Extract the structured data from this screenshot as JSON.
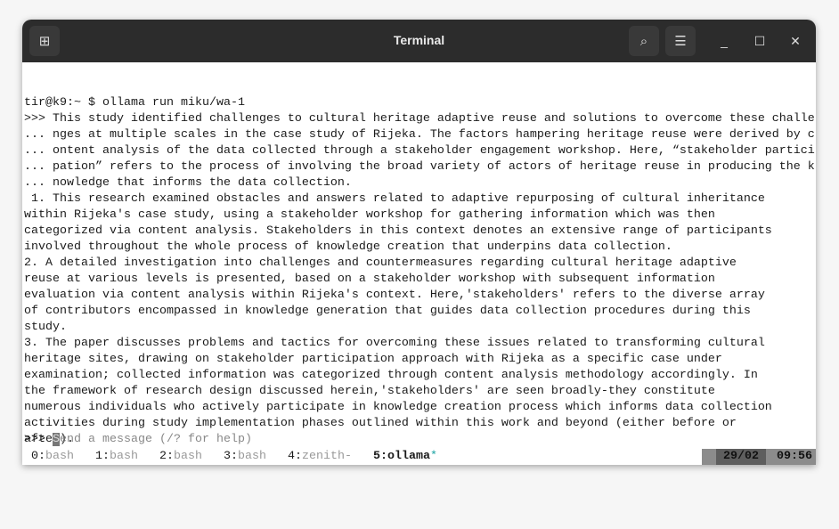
{
  "window": {
    "title": "Terminal"
  },
  "terminal": {
    "lines": [
      "tir@k9:~ $ ollama run miku/wa-1",
      ">>> This study identified challenges to cultural heritage adaptive reuse and solutions to overcome these challe",
      "... nges at multiple scales in the case study of Rijeka. The factors hampering heritage reuse were derived by c",
      "... ontent analysis of the data collected through a stakeholder engagement workshop. Here, “stakeholder partici",
      "... pation” refers to the process of involving the broad variety of actors of heritage reuse in producing the k",
      "... nowledge that informs the data collection.",
      " 1. This research examined obstacles and answers related to adaptive repurposing of cultural inheritance",
      "within Rijeka's case study, using a stakeholder workshop for gathering information which was then",
      "categorized via content analysis. Stakeholders in this context denotes an extensive range of participants",
      "involved throughout the whole process of knowledge creation that underpins data collection.",
      "2. A detailed investigation into challenges and countermeasures regarding cultural heritage adaptive",
      "reuse at various levels is presented, based on a stakeholder workshop with subsequent information",
      "evaluation via content analysis within Rijeka's context. Here,'stakeholders' refers to the diverse array",
      "of contributors encompassed in knowledge generation that guides data collection procedures during this",
      "study.",
      "3. The paper discusses problems and tactics for overcoming these issues related to transforming cultural",
      "heritage sites, drawing on stakeholder participation approach with Rijeka as a specific case under",
      "examination; collected information was categorized through content analysis methodology accordingly. In",
      "the framework of research design discussed herein,'stakeholders' are seen broadly-they constitute",
      "numerous individuals who actively participate in knowledge creation process which informs data collection",
      "activities during study implementation phases outlined within this work and beyond (either before or",
      "after).",
      ""
    ],
    "input_prompt": ">>> ",
    "input_cursor_char": "S",
    "input_placeholder": "end a message (/? for help)"
  },
  "tmux": {
    "tabs": [
      {
        "num": "0:",
        "label": "bash"
      },
      {
        "num": "1:",
        "label": "bash"
      },
      {
        "num": "2:",
        "label": "bash"
      },
      {
        "num": "3:",
        "label": "bash"
      },
      {
        "num": "4:",
        "label": "zenith-"
      },
      {
        "num": "5:",
        "label": "ollama",
        "flag": "*"
      }
    ],
    "date": "29/02",
    "time": "09:56"
  }
}
